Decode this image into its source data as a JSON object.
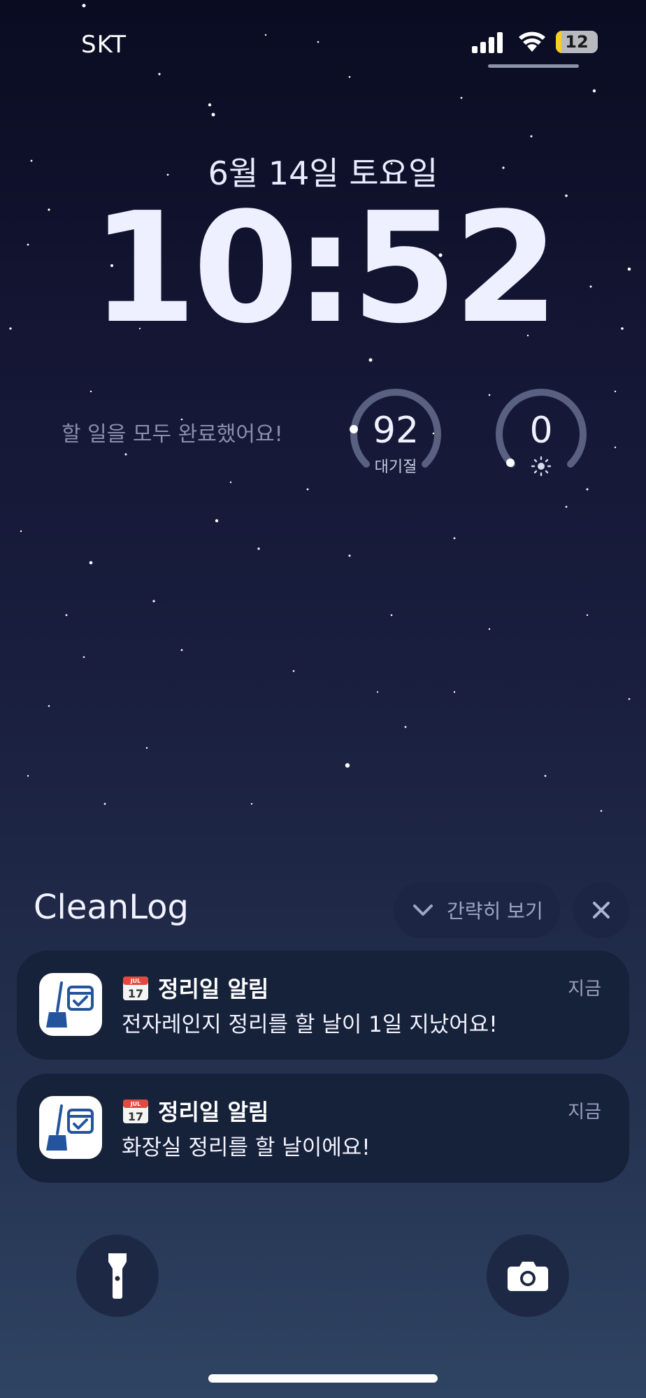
{
  "status_bar": {
    "carrier": "SKT",
    "battery_level": "12",
    "signal_icon": "cellular-signal-icon",
    "wifi_icon": "wifi-icon",
    "battery_color": "#f6cf24"
  },
  "lockscreen": {
    "date": "6월 14일 토요일",
    "time": "10:52"
  },
  "widgets": {
    "todo_text": "할 일을 모두 완료했어요!",
    "air_quality": {
      "value": "92",
      "label": "대기질"
    },
    "uv_index": {
      "value": "0",
      "icon": "sun-icon"
    }
  },
  "notification_group": {
    "app_name": "CleanLog",
    "collapse_label": "간략히 보기",
    "close_icon": "close-icon",
    "notifications": [
      {
        "title": "정리일 알림",
        "body": "전자레인지 정리를 할 날이 1일 지났어요!",
        "time": "지금",
        "cal_month": "JUL",
        "cal_day": "17"
      },
      {
        "title": "정리일 알림",
        "body": "화장실 정리를 할 날이에요!",
        "time": "지금",
        "cal_month": "JUL",
        "cal_day": "17"
      }
    ]
  },
  "quick_actions": {
    "flashlight_icon": "flashlight-icon",
    "camera_icon": "camera-icon"
  },
  "colors": {
    "notification_bg": "#16213a",
    "app_icon_blue": "#24549e"
  }
}
